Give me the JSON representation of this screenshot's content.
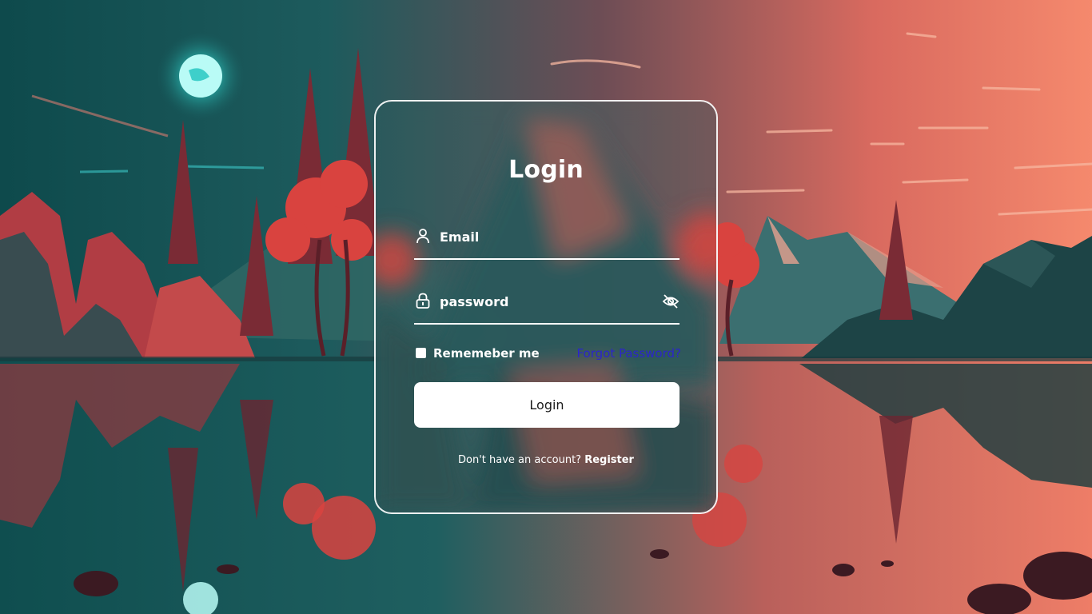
{
  "login_form": {
    "title": "Login",
    "email": {
      "placeholder": "Email",
      "value": "",
      "icon": "user-icon"
    },
    "password": {
      "placeholder": "password",
      "value": "",
      "icon": "lock-icon",
      "toggle_icon": "eye-off-icon"
    },
    "remember_label": "Rememeber me",
    "remember_checked": false,
    "forgot_link": "Forgot Password?",
    "submit_label": "Login",
    "register_prompt": "Don't have an account?",
    "register_link": "Register"
  },
  "colors": {
    "accent_link": "#2b25c9",
    "card_border": "#ffffff",
    "button_bg": "#ffffff"
  }
}
